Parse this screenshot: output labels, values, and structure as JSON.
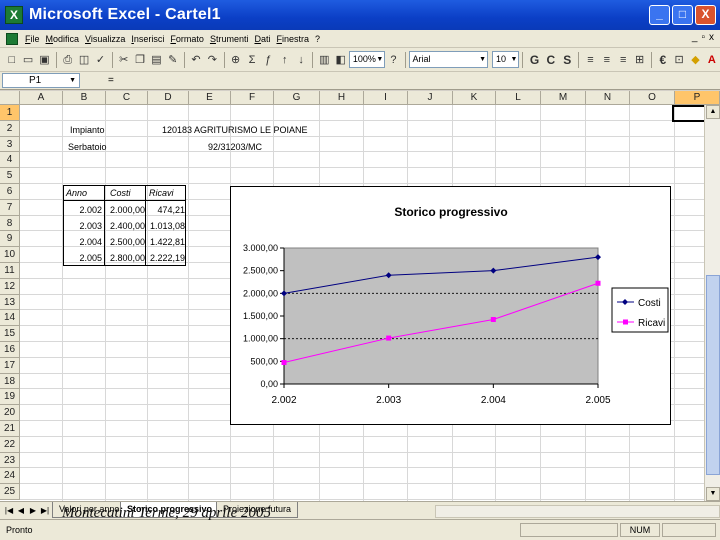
{
  "window": {
    "title": "Microsoft Excel - Cartel1",
    "app_icon": "excel-icon",
    "buttons": [
      "_",
      "□",
      "X"
    ]
  },
  "menu": [
    "File",
    "Modifica",
    "Visualizza",
    "Inserisci",
    "Formato",
    "Strumenti",
    "Dati",
    "Finestra",
    "?"
  ],
  "menu_right": [
    "_",
    "▫",
    "x"
  ],
  "toolbar": {
    "zoom": "100%",
    "font": "Arial",
    "size": "10",
    "bold": "G",
    "italic": "C",
    "underline": "S",
    "currency": "€"
  },
  "formula_bar": {
    "name_box": "P1",
    "equals": "="
  },
  "columns": [
    "A",
    "B",
    "C",
    "D",
    "E",
    "F",
    "G",
    "H",
    "I",
    "J",
    "K",
    "L",
    "M",
    "N",
    "O",
    "P"
  ],
  "rows": [
    "1",
    "2",
    "3",
    "4",
    "5",
    "6",
    "7",
    "8",
    "9",
    "10",
    "11",
    "12",
    "13",
    "14",
    "15",
    "16",
    "17",
    "18",
    "19",
    "20",
    "21",
    "22",
    "23",
    "24",
    "25"
  ],
  "cells": {
    "b2": "Impianto",
    "d2": "120183 AGRITURISMO LE POIANE",
    "b3": "Serbatoio",
    "e3": "92/31203/MC",
    "header_anno": "Anno",
    "header_costi": "Costi",
    "header_ricavi": "Ricavi",
    "table_rows": [
      [
        "2.002",
        "2.000,00",
        "474,21"
      ],
      [
        "2.003",
        "2.400,00",
        "1.013,08"
      ],
      [
        "2.004",
        "2.500,00",
        "1.422,81"
      ],
      [
        "2.005",
        "2.800,00",
        "2.222,19"
      ]
    ]
  },
  "chart_data": {
    "type": "line",
    "title": "Storico progressivo",
    "categories": [
      "2.002",
      "2.003",
      "2.004",
      "2.005"
    ],
    "y_ticks": [
      "0,00",
      "500,00",
      "1.000,00",
      "1.500,00",
      "2.000,00",
      "2.500,00",
      "3.000,00"
    ],
    "ylim": [
      0,
      3000
    ],
    "grid": "major-y-dotted",
    "legend": "right",
    "plot_bg": "#c0c0c0",
    "series": [
      {
        "name": "Costi",
        "values": [
          2000,
          2400,
          2500,
          2800
        ],
        "color": "#000080",
        "marker": "diamond"
      },
      {
        "name": "Ricavi",
        "values": [
          474.21,
          1013.08,
          1422.81,
          2222.19
        ],
        "color": "#ff00ff",
        "marker": "square"
      }
    ]
  },
  "sheet_tabs": [
    "Valori per anno",
    "Storico progressivo",
    "Proiezione futura"
  ],
  "active_tab": 1,
  "status": {
    "left": "Pronto",
    "num": "NUM"
  },
  "caption": "Montecatini Terme, 29 aprile 2005"
}
